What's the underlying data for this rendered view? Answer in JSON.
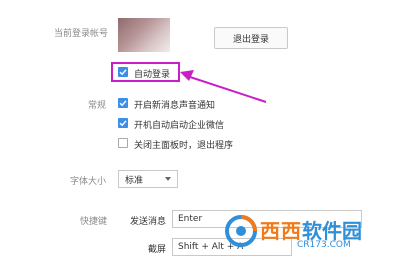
{
  "account": {
    "label": "当前登录帐号",
    "logout_label": "退出登录",
    "auto_login_label": "自动登录",
    "auto_login_checked": true
  },
  "general": {
    "label": "常规",
    "options": [
      {
        "label": "开启新消息声音通知",
        "checked": true
      },
      {
        "label": "开机自动启动企业微信",
        "checked": true
      },
      {
        "label": "关闭主面板时，退出程序",
        "checked": false
      }
    ]
  },
  "font": {
    "label": "字体大小",
    "value": "标准"
  },
  "shortcuts": {
    "label": "快捷键",
    "send_label": "发送消息",
    "send_value": "Enter",
    "screenshot_label": "截屏",
    "screenshot_value": "Shift + Alt + A"
  },
  "watermark": {
    "text_a": "西西",
    "text_b": "软件园",
    "url": "CR173.COM"
  },
  "colors": {
    "accent": "#3d8ee8",
    "highlight": "#c71ec7"
  }
}
